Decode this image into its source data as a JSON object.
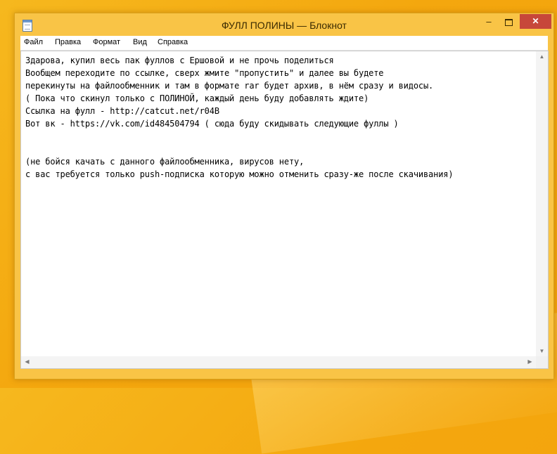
{
  "window": {
    "title": "ФУЛЛ ПОЛИНЫ — Блокнот",
    "minimize_glyph": "‒",
    "close_glyph": "✕"
  },
  "menu": [
    "Файл",
    "Правка",
    "Формат",
    "Вид",
    "Справка"
  ],
  "document": {
    "lines": [
      "Здарова, купил весь пак фуллов с Ершовой и не прочь поделиться",
      "Вообщем переходите по ссылке, сверх жмите \"пропустить\" и далее вы будете",
      "перекинуты на файлообменник и там в формате rar будет архив, в нём сразу и видосы.",
      "( Пока что скинул только с ПОЛИНОЙ, каждый день буду добавлять ждите)",
      "Ссылка на фулл - http://catcut.net/r04B",
      "Вот вк - https://vk.com/id484504794 ( сюда буду скидывать следующие фуллы )",
      "",
      "",
      "(не бойся качать с данного файлообменника, вирусов нету,",
      "с вас требуется только push-подписка которую можно отменить сразу-же после скачивания)"
    ]
  },
  "scrollbar_arrows": {
    "up": "▲",
    "down": "▼",
    "left": "◀",
    "right": "▶"
  },
  "colors": {
    "desktop": "#f4a70e",
    "window_frame": "#f9c446",
    "close_button": "#c7473a"
  }
}
